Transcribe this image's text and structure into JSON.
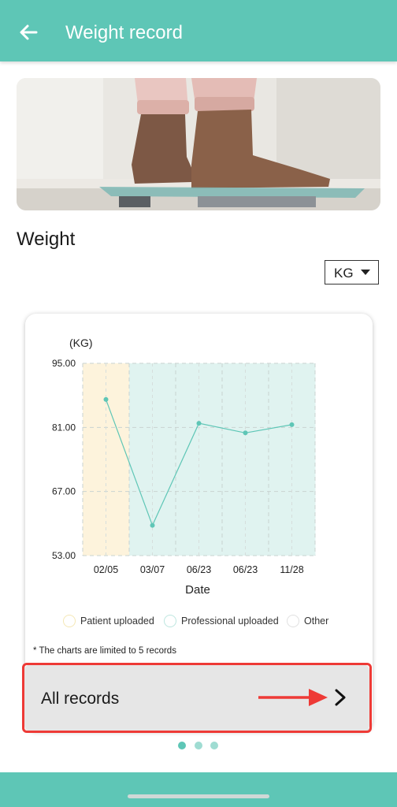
{
  "header": {
    "title": "Weight record",
    "back_icon": "arrow-left-icon"
  },
  "hero": {
    "alt": "bare feet on a glass bathroom scale"
  },
  "section": {
    "title": "Weight"
  },
  "unit_selector": {
    "value": "KG"
  },
  "chart_data": {
    "type": "line",
    "unit_label": "(KG)",
    "xlabel": "Date",
    "categories": [
      "02/05",
      "03/07",
      "06/23",
      "06/23",
      "11/28"
    ],
    "values": [
      87.1,
      59.6,
      81.9,
      79.8,
      81.6
    ],
    "ylim": [
      53.0,
      95.0
    ],
    "yticks": [
      "95.00",
      "81.00",
      "67.00",
      "53.00"
    ],
    "grid": true,
    "line_color": "#5ec6b6",
    "band_colors": {
      "patient": "#fdf3dc",
      "professional": "#e0f3f0"
    },
    "bands": [
      "patient",
      "professional",
      "professional",
      "professional",
      "professional"
    ],
    "legend": [
      {
        "label": "Patient uploaded",
        "color": "#f4e7b5"
      },
      {
        "label": "Professional uploaded",
        "color": "#bde6df"
      },
      {
        "label": "Other",
        "color": "#e0e0e0"
      }
    ]
  },
  "chart_note": "* The charts are limited to 5 records",
  "all_records": {
    "label": "All records",
    "chevron_icon": "chevron-right-icon"
  },
  "pager": {
    "active_color": "#5ec6b6",
    "inactive_color": "#9fdcd2"
  }
}
